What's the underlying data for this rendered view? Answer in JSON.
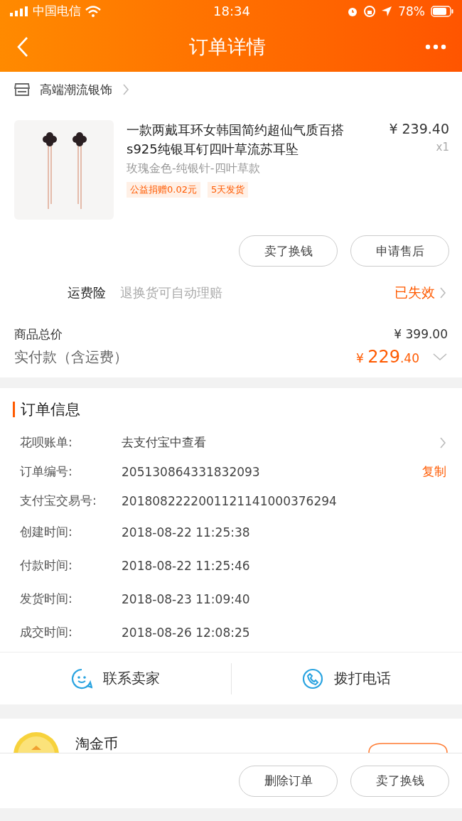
{
  "status_bar": {
    "carrier": "中国电信",
    "time": "18:34",
    "battery": "78%"
  },
  "nav": {
    "title": "订单详情"
  },
  "shop": {
    "name": "高端潮流银饰"
  },
  "product": {
    "title": "一款两戴耳环女韩国简约超仙气质百搭s925纯银耳钉四叶草流苏耳坠",
    "price": "¥ 239.40",
    "quantity": "x1",
    "sku": "玫瑰金色-纯银针-四叶草款",
    "tags": [
      "公益捐赠0.02元",
      "5天发货"
    ]
  },
  "item_buttons": [
    "卖了换钱",
    "申请售后"
  ],
  "insurance": {
    "label": "运费险",
    "description": "退换货可自动理赔",
    "status": "已失效"
  },
  "totals": {
    "goods_label": "商品总价",
    "goods_value": "¥ 399.00",
    "paid_label": "实付款（含运费）",
    "paid_currency": "¥",
    "paid_integer": "229",
    "paid_decimal": ".40"
  },
  "order_info": {
    "title": "订单信息",
    "rows": [
      {
        "kind": "link",
        "label": "花呗账单:",
        "value": "去支付宝中查看"
      },
      {
        "kind": "copy",
        "label": "订单编号:",
        "value": "205130864331832093",
        "action_text": "复制"
      },
      {
        "kind": "plain",
        "label": "支付宝交易号:",
        "value": "2018082222001121141000376294"
      },
      {
        "kind": "plain",
        "label": "创建时间:",
        "value": "2018-08-22 11:25:38"
      },
      {
        "kind": "plain",
        "label": "付款时间:",
        "value": "2018-08-22 11:25:46"
      },
      {
        "kind": "plain",
        "label": "发货时间:",
        "value": "2018-08-23 11:09:40"
      },
      {
        "kind": "plain",
        "label": "成交时间:",
        "value": "2018-08-26 12:08:25"
      }
    ]
  },
  "contact": [
    {
      "kind": "chat",
      "label": "联系卖家"
    },
    {
      "kind": "phone",
      "label": "拨打电话"
    }
  ],
  "coins": {
    "title": "淘金币"
  },
  "bottom_buttons": [
    "删除订单",
    "卖了换钱"
  ]
}
